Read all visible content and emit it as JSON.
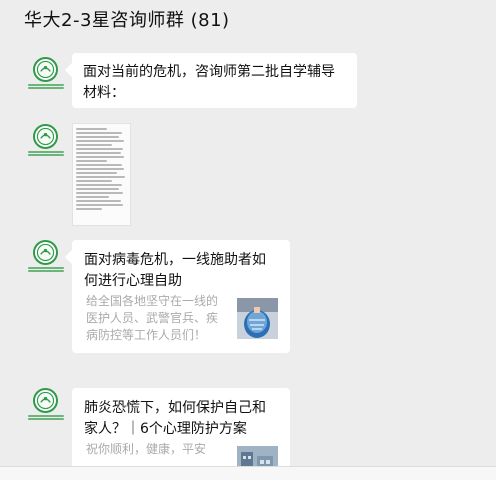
{
  "chat": {
    "title": "华大2-3星咨询师群 (81)"
  },
  "messages": [
    {
      "type": "text",
      "text": "面对当前的危机，咨询师第二批自学辅导材料："
    },
    {
      "type": "document"
    },
    {
      "type": "link",
      "title": "面对病毒危机，一线施助者如何进行心理自助",
      "description": "给全国各地坚守在一线的医护人员、武警官兵、疾病防控等工作人员们！"
    },
    {
      "type": "link",
      "title": "肺炎恐慌下，如何保护自己和家人？｜6个心理防护方案",
      "description": "祝你顺利，健康，平安"
    }
  ],
  "icons": {
    "avatar": "org-logo-icon",
    "document": "document-preview-icon"
  },
  "colors": {
    "background": "#ededed",
    "bubble": "#ffffff",
    "avatar_ring": "#2f9a4a",
    "muted_text": "#aaaaaa"
  }
}
